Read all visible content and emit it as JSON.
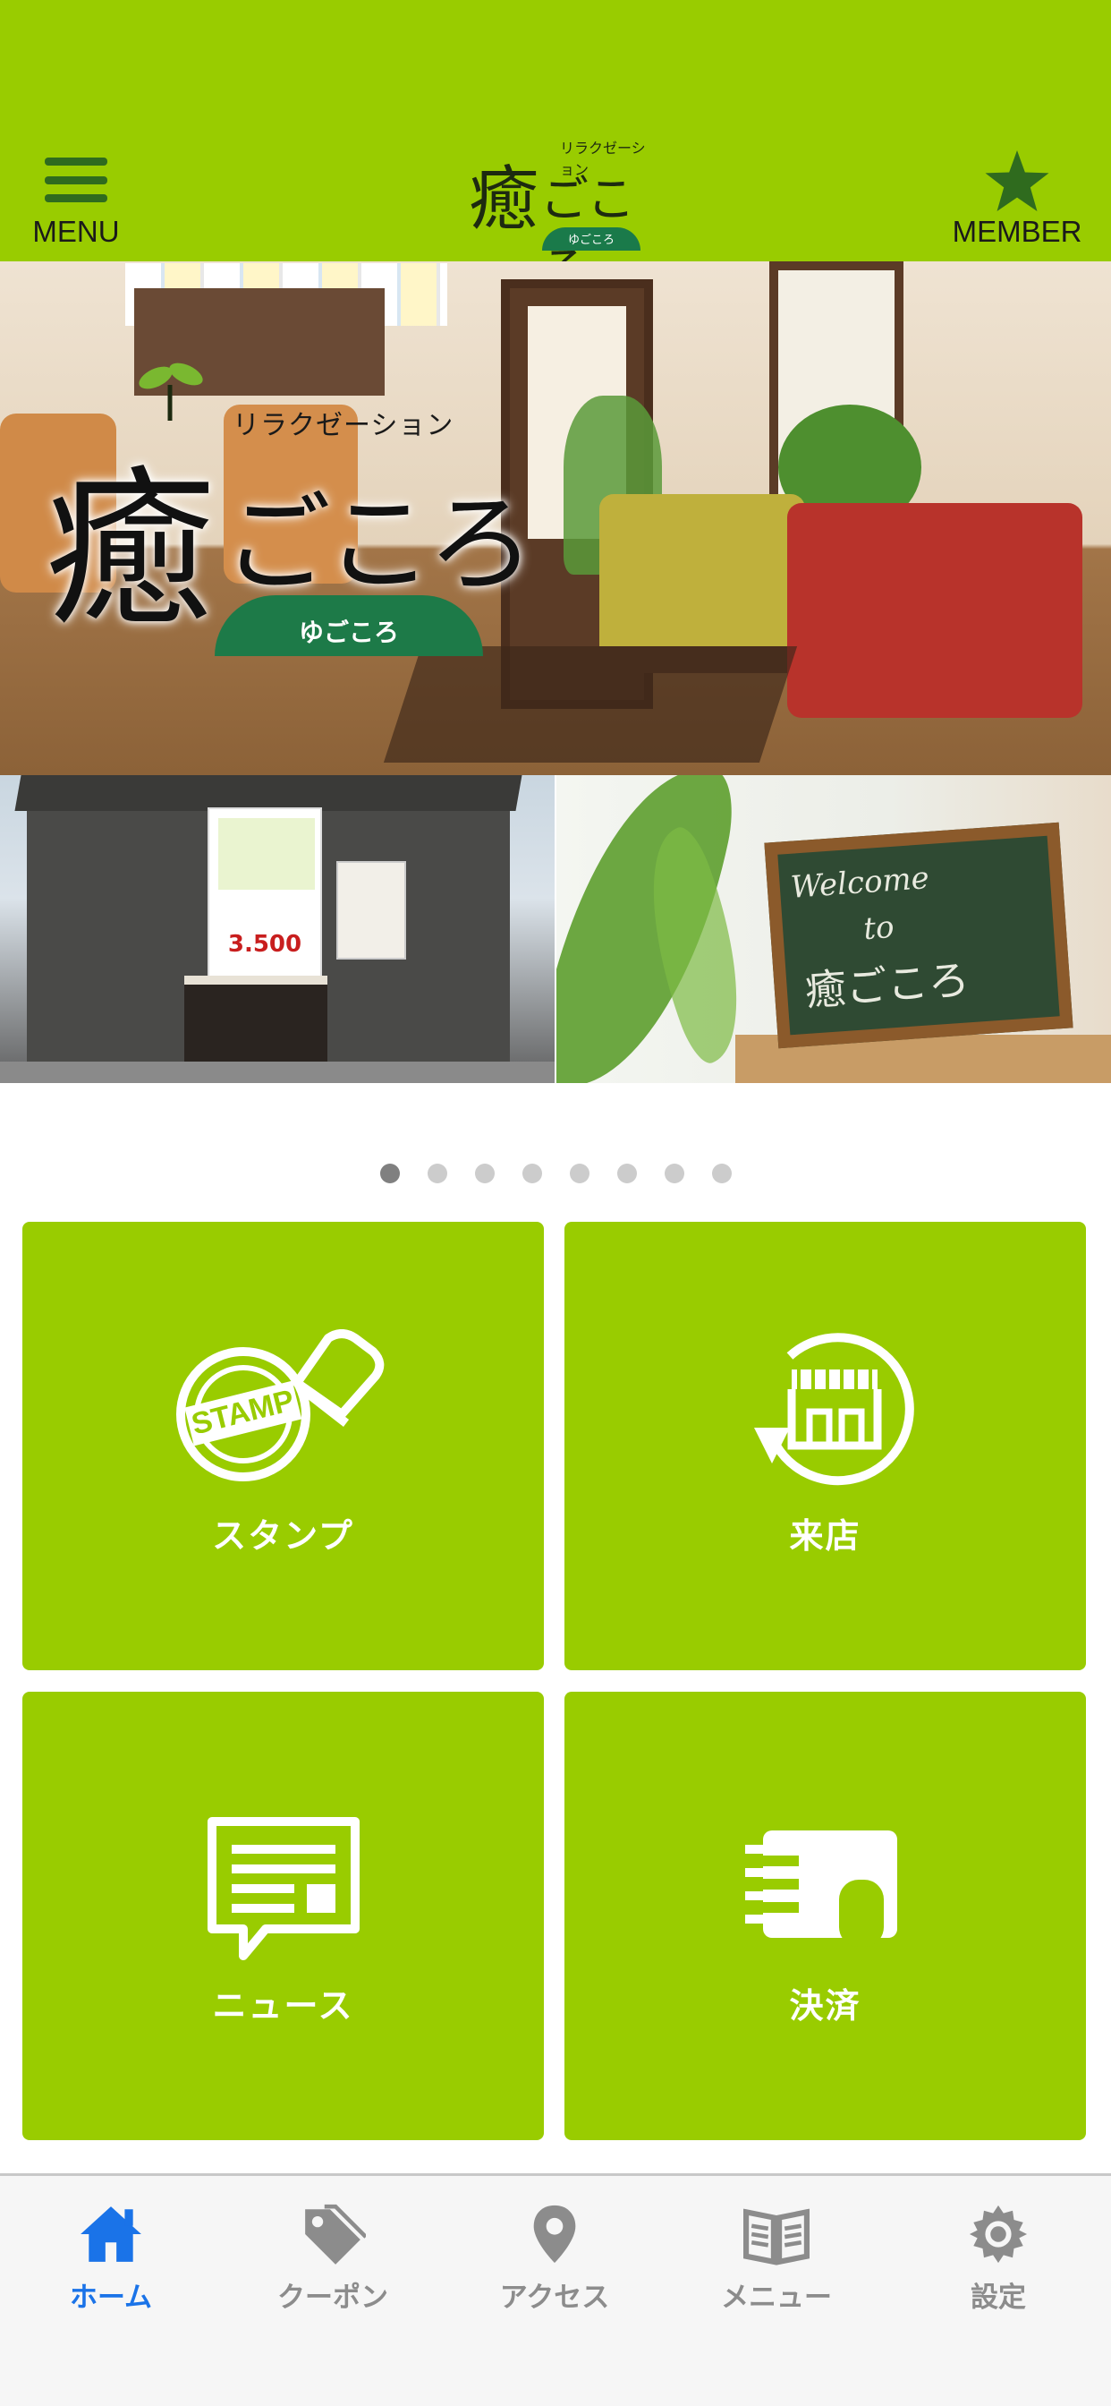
{
  "header": {
    "menu_label": "MENU",
    "member_label": "MEMBER",
    "logo": {
      "tagline": "リラクゼーション",
      "name_kanji": "癒",
      "name_kana": "ごころ",
      "reading": "ゆごころ"
    },
    "colors": {
      "brand": "#99cc00",
      "icon_dark": "#2f6b1e"
    }
  },
  "hero": {
    "logo": {
      "tagline": "リラクゼーション",
      "name_kanji": "癒",
      "name_kana": "ごころ",
      "reading": "ゆごころ"
    }
  },
  "sub_images": {
    "left": {
      "price": "3.500"
    },
    "right": {
      "board_line1": "Welcome",
      "board_line2": "to",
      "board_line3": "癒ごころ"
    }
  },
  "carousel": {
    "count": 8,
    "active_index": 0
  },
  "tiles": [
    {
      "label": "スタンプ",
      "icon": "stamp-icon"
    },
    {
      "label": "来店",
      "icon": "store-checkin-icon"
    },
    {
      "label": "ニュース",
      "icon": "news-icon"
    },
    {
      "label": "決済",
      "icon": "payment-icon"
    }
  ],
  "tabbar": {
    "items": [
      {
        "label": "ホーム",
        "icon": "home-icon",
        "active": true
      },
      {
        "label": "クーポン",
        "icon": "coupon-icon",
        "active": false
      },
      {
        "label": "アクセス",
        "icon": "location-pin-icon",
        "active": false
      },
      {
        "label": "メニュー",
        "icon": "book-icon",
        "active": false
      },
      {
        "label": "設定",
        "icon": "gear-icon",
        "active": false
      }
    ],
    "colors": {
      "active": "#1a73e8",
      "inactive": "#8c8c8c"
    }
  }
}
